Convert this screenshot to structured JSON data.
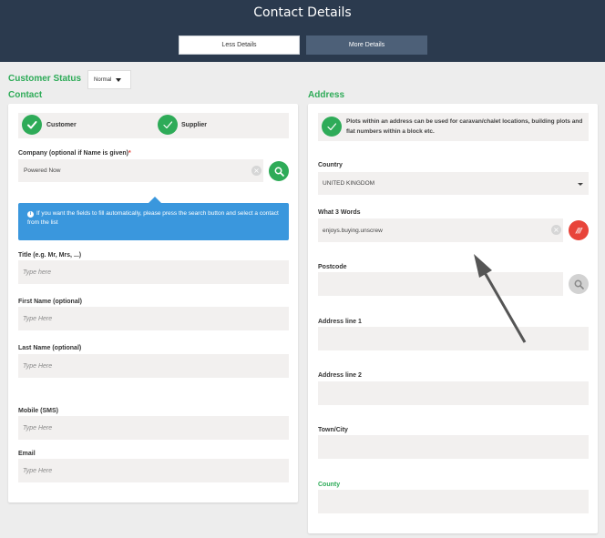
{
  "header": {
    "title": "Contact Details",
    "less_details": "Less Details",
    "more_details": "More Details"
  },
  "customer_status": {
    "label": "Customer Status",
    "selected": "Normal"
  },
  "contact": {
    "title": "Contact",
    "customer_label": "Customer",
    "supplier_label": "Supplier",
    "company_label": "Company (optional if Name is given)",
    "required_mark": "*",
    "company_value": "Powered Now",
    "info_message": "If you want the fields to fill automatically, please press the search button and select a contact from the list",
    "title_label": "Title (e.g. Mr, Mrs, ...)",
    "title_placeholder": "Type here",
    "first_name_label": "First Name (optional)",
    "first_name_placeholder": "Type Here",
    "last_name_label": "Last Name (optional)",
    "last_name_placeholder": "Type Here",
    "mobile_label": "Mobile (SMS)",
    "mobile_placeholder": "Type Here",
    "email_label": "Email",
    "email_placeholder": "Type Here"
  },
  "address": {
    "title": "Address",
    "plots_info": "Plots within an address can be used for caravan/chalet locations, building plots and flat numbers within a block etc.",
    "country_label": "Country",
    "country_value": "UNITED KINGDOM",
    "w3w_label": "What 3 Words",
    "w3w_value": "enjoys.buying.unscrew",
    "w3w_button": "///",
    "postcode_label": "Postcode",
    "address1_label": "Address line 1",
    "address2_label": "Address line 2",
    "town_label": "Town/City",
    "county_label": "County"
  },
  "colors": {
    "header_bg": "#2b3a4e",
    "accent_green": "#2eab58",
    "info_blue": "#3a97dd",
    "w3w_red": "#e8443a"
  },
  "icons": [
    "check-icon",
    "search-icon",
    "info-icon",
    "clear-icon",
    "what3words-icon",
    "dropdown-caret-icon",
    "arrow-annotation"
  ]
}
